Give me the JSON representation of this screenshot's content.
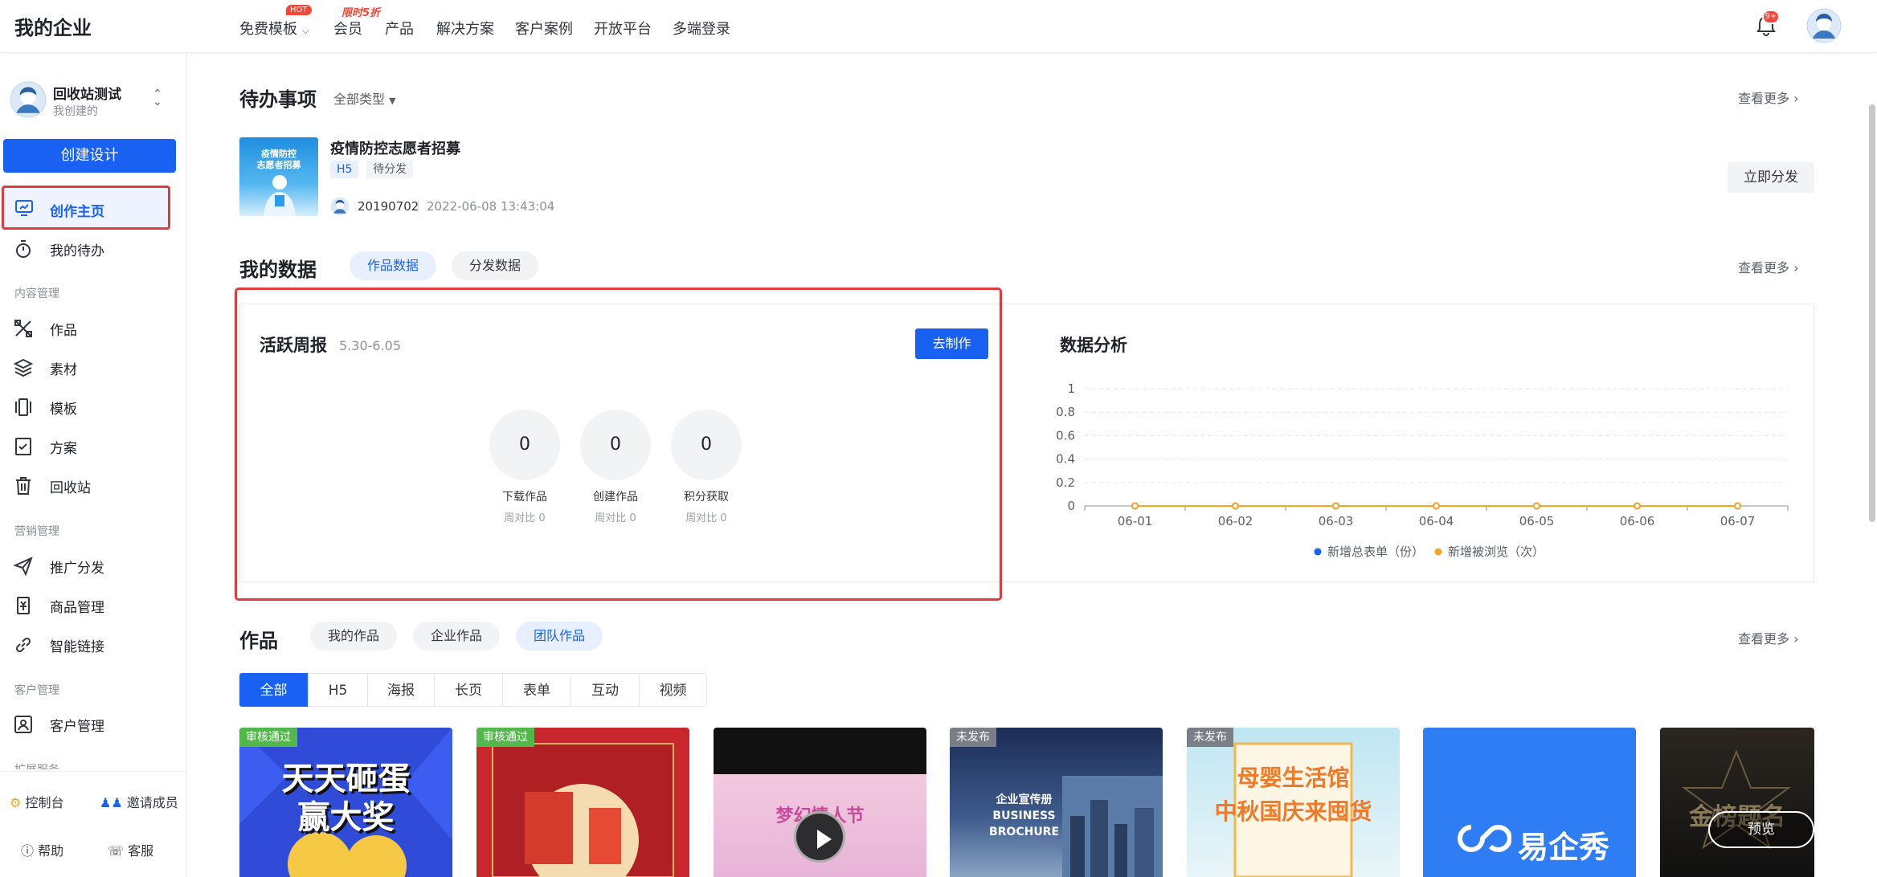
{
  "header": {
    "brand": "我的企业",
    "nav": [
      "免费模板",
      "会员",
      "产品",
      "解决方案",
      "客户案例",
      "开放平台",
      "多端登录"
    ],
    "hot_badge": "HOT",
    "promo_badge": "限时5折",
    "notification_count": "9+"
  },
  "sidebar": {
    "account_name": "回收站测试",
    "account_sub": "我创建的",
    "create_label": "创建设计",
    "items_top": [
      "创作主页",
      "我的待办"
    ],
    "group_content": "内容管理",
    "items_content": [
      "作品",
      "素材",
      "模板",
      "方案",
      "回收站"
    ],
    "group_marketing": "营销管理",
    "items_marketing": [
      "推广分发",
      "商品管理",
      "智能链接"
    ],
    "group_customer": "客户管理",
    "items_customer": [
      "客户管理"
    ],
    "group_extend": "扩展服务",
    "console": "控制台",
    "invite": "邀请成员",
    "help": "帮助",
    "service": "客服"
  },
  "todo": {
    "title": "待办事项",
    "filter": "全部类型",
    "more": "查看更多",
    "item_title": "疫情防控志愿者招募",
    "thumb_text": "疫情防控\n志愿者招募",
    "tag_type": "H5",
    "tag_status": "待分发",
    "user": "20190702",
    "time": "2022-06-08 13:43:04",
    "action": "立即分发"
  },
  "my_data": {
    "title": "我的数据",
    "tabs": [
      "作品数据",
      "分发数据"
    ],
    "more": "查看更多",
    "weekly_title": "活跃周报",
    "weekly_range": "5.30-6.05",
    "make_button": "去制作",
    "stats": [
      {
        "value": "0",
        "label": "下载作品",
        "sub": "周对比 0"
      },
      {
        "value": "0",
        "label": "创建作品",
        "sub": "周对比 0"
      },
      {
        "value": "0",
        "label": "积分获取",
        "sub": "周对比 0"
      }
    ],
    "analysis_title": "数据分析"
  },
  "chart_data": {
    "type": "line",
    "x": [
      "06-01",
      "06-02",
      "06-03",
      "06-04",
      "06-05",
      "06-06",
      "06-07"
    ],
    "yticks": [
      "1",
      "0.8",
      "0.6",
      "0.4",
      "0.2",
      "0"
    ],
    "ylim": [
      0,
      1
    ],
    "grid": true,
    "legend_position": "bottom",
    "series": [
      {
        "name": "新增总表单（份）",
        "values": [
          0,
          0,
          0,
          0,
          0,
          0,
          0
        ],
        "color": "#1861f2"
      },
      {
        "name": "新增被浏览（次）",
        "values": [
          0,
          0,
          0,
          0,
          0,
          0,
          0
        ],
        "color": "#f5a623"
      }
    ]
  },
  "works": {
    "title": "作品",
    "tabs": [
      "我的作品",
      "企业作品",
      "团队作品"
    ],
    "more": "查看更多",
    "filters": [
      "全部",
      "H5",
      "海报",
      "长页",
      "表单",
      "互动",
      "视频"
    ],
    "cards": [
      {
        "badge": "审核通过",
        "text": "天天砸蛋\n赢大奖"
      },
      {
        "badge": "审核通过",
        "text": ""
      },
      {
        "badge": "",
        "text": "梦幻情人节"
      },
      {
        "badge": "未发布",
        "text": "企业宣传册\nBUSINESS\nBROCHURE"
      },
      {
        "badge": "未发布",
        "text": "母婴生活馆\n中秋国庆来囤货"
      },
      {
        "badge": "",
        "text": "易企秀"
      },
      {
        "badge": "",
        "text": "金榜题名"
      }
    ],
    "preview": "预览"
  },
  "colors": {
    "accent": "#1861f2",
    "highlight_frame": "#e23b3b",
    "approved": "#52b84a",
    "unpublished": "#7a7f87"
  }
}
